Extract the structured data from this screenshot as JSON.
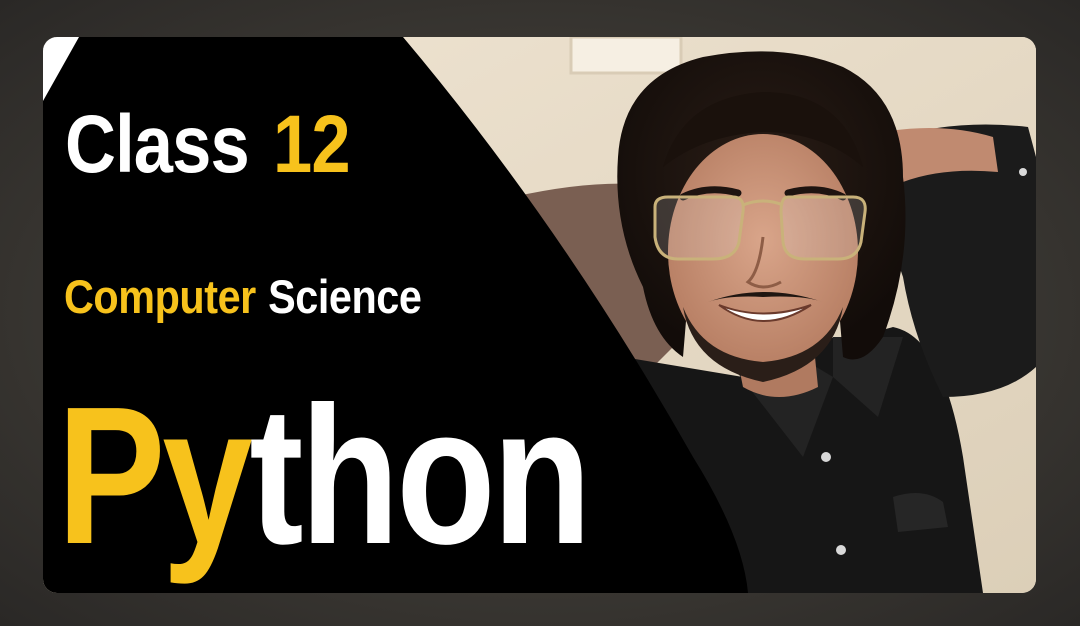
{
  "thumbnail": {
    "line1": {
      "word": "Class",
      "number": "12"
    },
    "line2": {
      "first": "Computer",
      "second": "Science"
    },
    "line3": {
      "highlight": "Py",
      "rest": "thon"
    }
  },
  "colors": {
    "accent_yellow": "#f7c21c",
    "text_white": "#ffffff",
    "panel_black": "#000000",
    "wall_cream": "#e9ddc9",
    "page_backdrop": "#3a3835"
  }
}
